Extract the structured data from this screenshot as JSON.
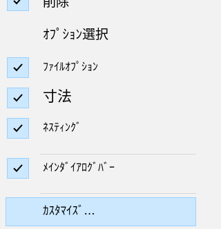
{
  "menu": {
    "items": [
      {
        "label": "削除",
        "checked": true
      },
      {
        "label": "ｵﾌﾟｼｮﾝ選択",
        "checked": false
      },
      {
        "label": "ﾌｧｲﾙｵﾌﾟｼｮﾝ",
        "checked": true
      },
      {
        "label": "寸法",
        "checked": true
      },
      {
        "label": "ﾈｽﾃｨﾝｸﾞ",
        "checked": true
      },
      {
        "label": "ﾒｲﾝﾀﾞｲｱﾛｸﾞﾊﾞｰ",
        "checked": true
      },
      {
        "label": "ｶｽﾀﾏｲｽﾞ...",
        "checked": false,
        "highlighted": true
      }
    ]
  },
  "colors": {
    "background": "#f2f2f2",
    "check_fill": "#cce8ff",
    "check_border": "#99d1ff",
    "separator": "#d7d7d7"
  },
  "icons": {
    "check": "checkmark-icon"
  }
}
